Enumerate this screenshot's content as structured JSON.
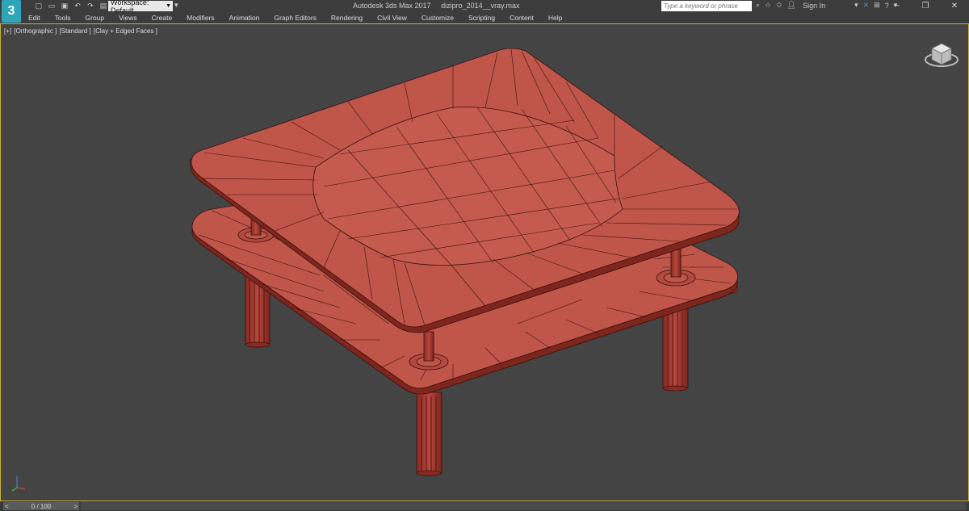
{
  "app": {
    "logo": "3",
    "title": "Autodesk 3ds Max 2017",
    "filename": "dizipro_2014__vray.max"
  },
  "quick_access": {
    "icons": [
      "new-file-icon",
      "open-icon",
      "save-icon",
      "undo-icon",
      "redo-icon",
      "project-folder-icon"
    ],
    "workspace_label": "Workspace: Default"
  },
  "search": {
    "placeholder": "Type a keyword or phrase"
  },
  "account": {
    "sign_in": "Sign In"
  },
  "window_buttons": [
    "minimize",
    "restore",
    "close"
  ],
  "menu": [
    "Edit",
    "Tools",
    "Group",
    "Views",
    "Create",
    "Modifiers",
    "Animation",
    "Graph Editors",
    "Rendering",
    "Civil View",
    "Customize",
    "Scripting",
    "Content",
    "Help"
  ],
  "viewport": {
    "labels": [
      "[+]",
      "[Orthographic ]",
      "[Standard ]",
      "[Clay + Edged Faces ]"
    ],
    "border_color": "#c8b040",
    "background": "#444444",
    "object_color": "#c0564a",
    "edge_color": "#3a0f0c"
  },
  "timeline": {
    "frame_label": "0 / 100",
    "prev": "<",
    "next": ">"
  }
}
